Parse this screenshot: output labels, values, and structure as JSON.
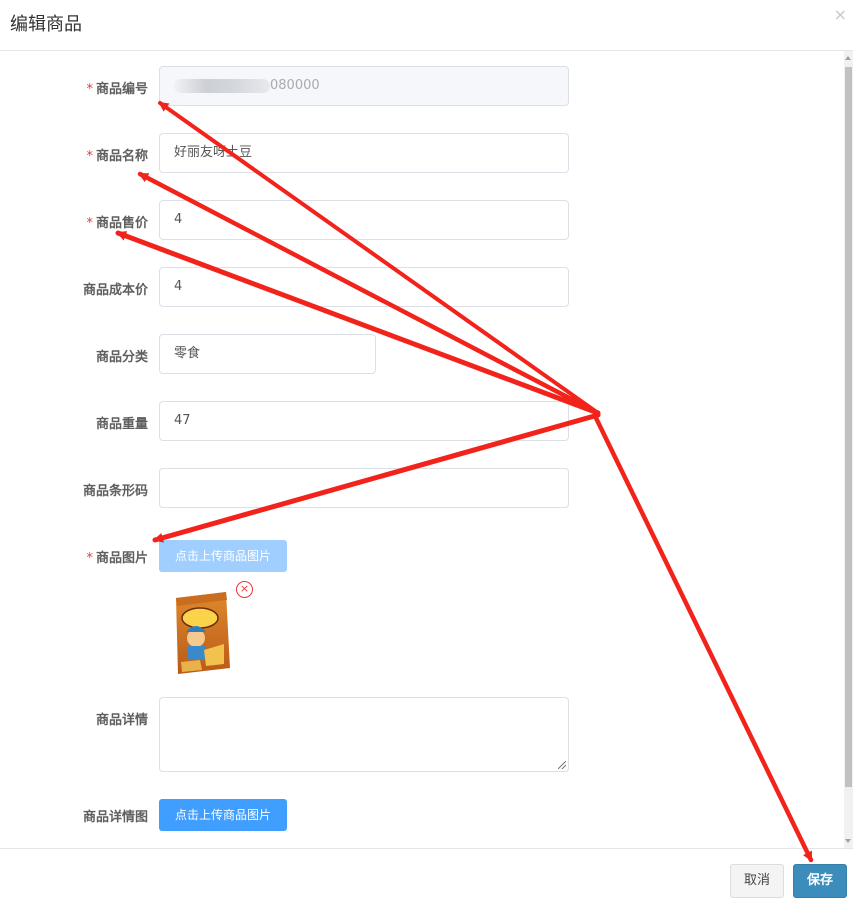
{
  "dialog": {
    "title": "编辑商品",
    "close_glyph": "×"
  },
  "form": {
    "required_mark": "*",
    "code": {
      "label": "商品编号",
      "value_visible": "080000",
      "required": true
    },
    "name": {
      "label": "商品名称",
      "value": "好丽友呀土豆",
      "required": true
    },
    "price": {
      "label": "商品售价",
      "value": "4",
      "required": true
    },
    "cost": {
      "label": "商品成本价",
      "value": "4",
      "required": false
    },
    "category": {
      "label": "商品分类",
      "value": "零食",
      "required": false
    },
    "weight": {
      "label": "商品重量",
      "value": "47",
      "required": false
    },
    "barcode": {
      "label": "商品条形码",
      "value": "",
      "required": false
    },
    "image": {
      "label": "商品图片",
      "upload_label": "点击上传商品图片",
      "required": true,
      "remove_glyph": "×"
    },
    "detail": {
      "label": "商品详情",
      "value": ""
    },
    "detail_image": {
      "label": "商品详情图",
      "upload_label": "点击上传商品图片"
    }
  },
  "footer": {
    "cancel_label": "取消",
    "save_label": "保存"
  },
  "colors": {
    "primary": "#409eff",
    "save": "#3c8dbc",
    "required": "#e4393c",
    "annotation_arrow": "#f2231b"
  },
  "icons": [
    "close-icon",
    "remove-image-icon",
    "resize-handle-icon"
  ]
}
